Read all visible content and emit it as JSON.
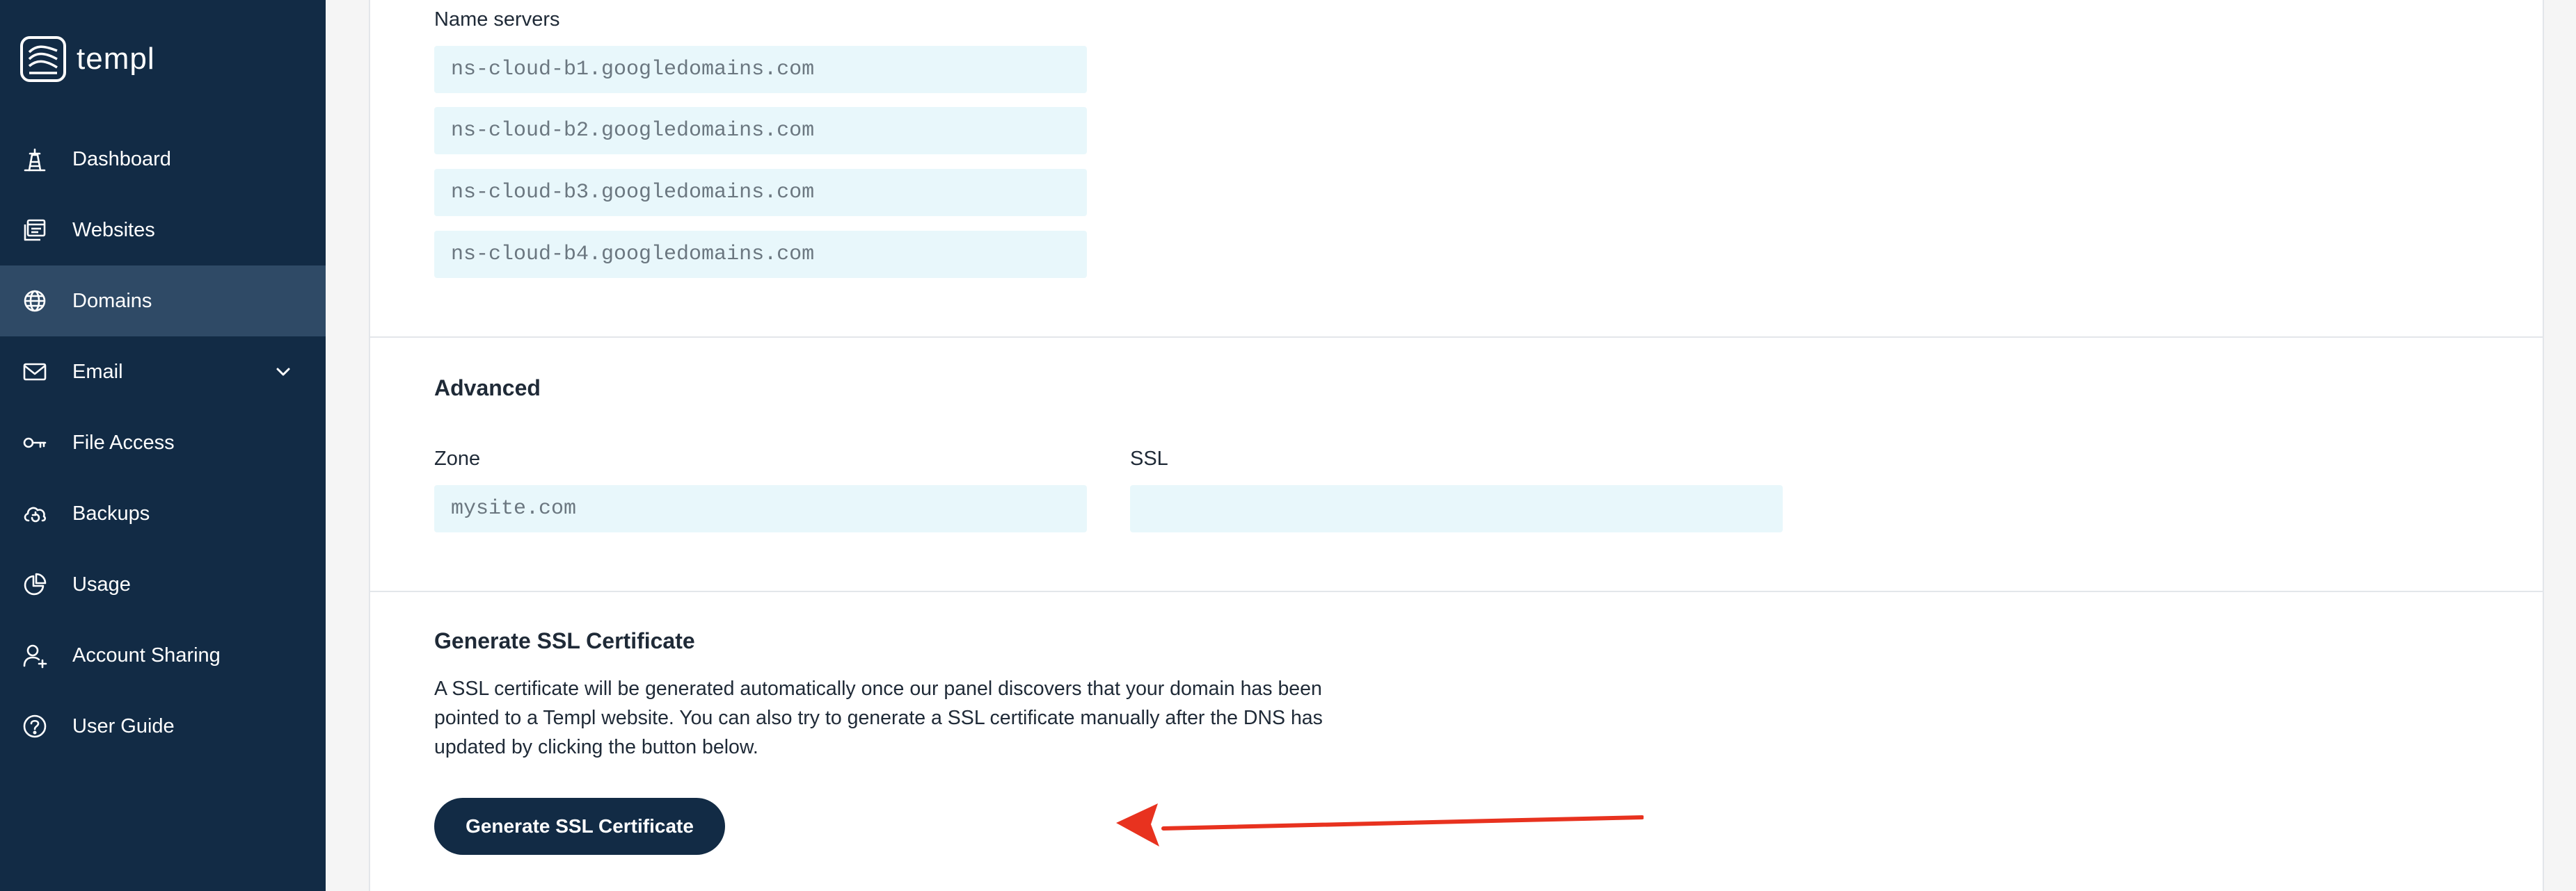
{
  "brand": {
    "name": "templ"
  },
  "sidebar": {
    "items": [
      {
        "label": "Dashboard",
        "icon": "dashboard-icon"
      },
      {
        "label": "Websites",
        "icon": "websites-icon"
      },
      {
        "label": "Domains",
        "icon": "globe-icon",
        "active": true
      },
      {
        "label": "Email",
        "icon": "mail-icon",
        "expandable": true
      },
      {
        "label": "File Access",
        "icon": "key-icon"
      },
      {
        "label": "Backups",
        "icon": "cloud-backup-icon"
      },
      {
        "label": "Usage",
        "icon": "pie-chart-icon"
      },
      {
        "label": "Account Sharing",
        "icon": "user-add-icon"
      },
      {
        "label": "User Guide",
        "icon": "help-icon"
      }
    ]
  },
  "nameservers": {
    "label": "Name servers",
    "values": [
      "ns-cloud-b1.googledomains.com",
      "ns-cloud-b2.googledomains.com",
      "ns-cloud-b3.googledomains.com",
      "ns-cloud-b4.googledomains.com"
    ]
  },
  "advanced": {
    "title": "Advanced",
    "zone_label": "Zone",
    "zone_value": "mysite.com",
    "ssl_label": "SSL",
    "ssl_value": ""
  },
  "generate_ssl": {
    "title": "Generate SSL Certificate",
    "description": "A SSL certificate will be generated automatically once our panel discovers that your domain has been pointed to a Templ website. You can also try to generate a SSL certificate manually after the DNS has updated by clicking the button below.",
    "button_label": "Generate SSL Certificate"
  },
  "colors": {
    "sidebar_bg": "#122b45",
    "active_item_bg": "#2f4a66",
    "field_bg": "#e8f7fb",
    "button_bg": "#122b45",
    "annotation_arrow": "#e8321f"
  }
}
